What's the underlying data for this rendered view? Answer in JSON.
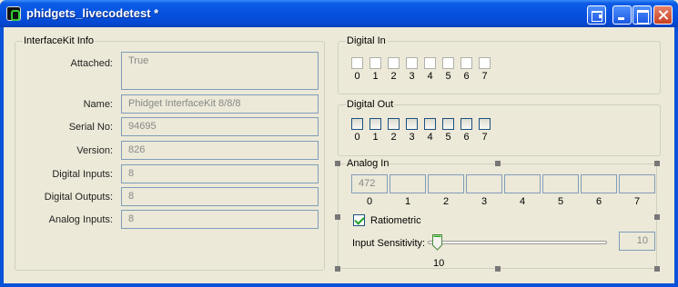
{
  "window": {
    "title": "phidgets_livecodetest *"
  },
  "interfacekit_info": {
    "group_label": "InterfaceKit Info",
    "rows": [
      {
        "label": "Attached:",
        "value": "True"
      },
      {
        "label": "Name:",
        "value": "Phidget InterfaceKit 8/8/8"
      },
      {
        "label": "Serial No:",
        "value": "94695"
      },
      {
        "label": "Version:",
        "value": "826"
      },
      {
        "label": "Digital Inputs:",
        "value": "8"
      },
      {
        "label": "Digital Outputs:",
        "value": "8"
      },
      {
        "label": "Analog Inputs:",
        "value": "8"
      }
    ]
  },
  "digital_in": {
    "group_label": "Digital In",
    "indices": [
      "0",
      "1",
      "2",
      "3",
      "4",
      "5",
      "6",
      "7"
    ],
    "checked": [
      false,
      false,
      false,
      false,
      false,
      false,
      false,
      false
    ]
  },
  "digital_out": {
    "group_label": "Digital Out",
    "indices": [
      "0",
      "1",
      "2",
      "3",
      "4",
      "5",
      "6",
      "7"
    ],
    "checked": [
      false,
      false,
      false,
      false,
      false,
      false,
      false,
      false
    ]
  },
  "analog_in": {
    "group_label": "Analog In",
    "values": [
      "472",
      "",
      "",
      "",
      "",
      "",
      "",
      ""
    ],
    "indices": [
      "0",
      "1",
      "2",
      "3",
      "4",
      "5",
      "6",
      "7"
    ],
    "ratiometric_label": "Ratiometric",
    "ratiometric_checked": true,
    "sensitivity_label": "Input Sensitivity:",
    "sensitivity_value": "10",
    "sensitivity_tick_label": "10",
    "sensitivity_fraction": 0.0
  },
  "colors": {
    "title_bar": "#0552e0",
    "window_bg": "#ece9d8",
    "field_border": "#7f9db9",
    "check_green": "#21a121"
  }
}
